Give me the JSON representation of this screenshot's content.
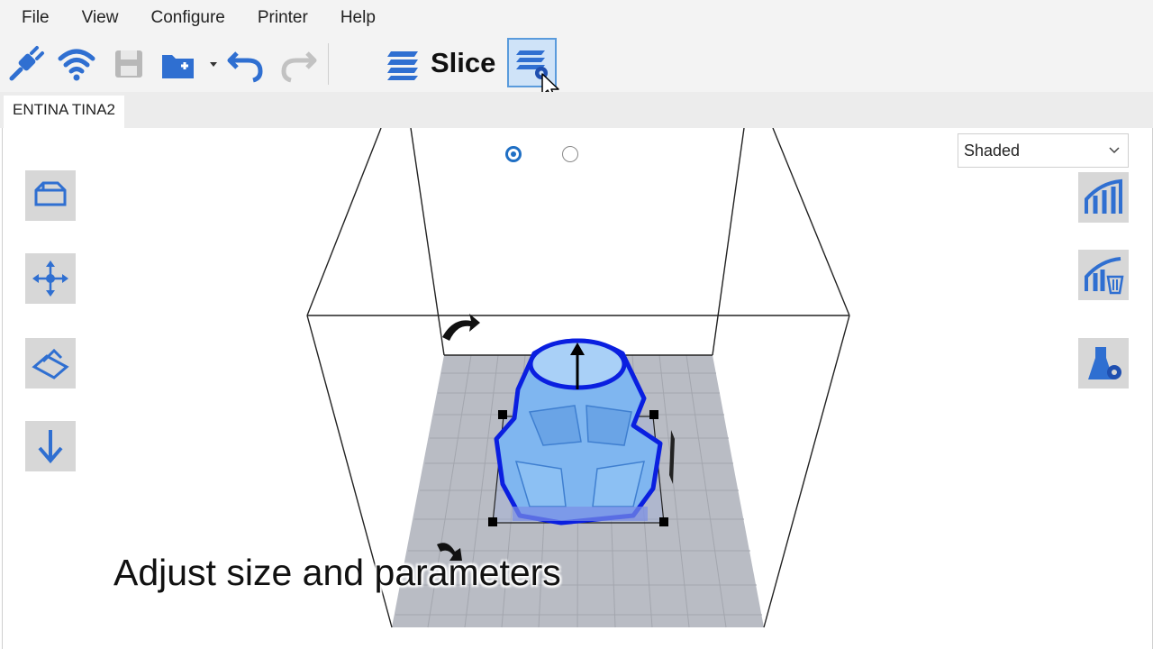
{
  "menu": [
    "File",
    "View",
    "Configure",
    "Printer",
    "Help"
  ],
  "toolbar": {
    "slice_label": "Slice",
    "icons": [
      "usb-connect-icon",
      "wifi-icon",
      "save-icon",
      "open-folder-icon",
      "undo-icon",
      "redo-icon",
      "slice-layers-icon",
      "slice-settings-icon"
    ]
  },
  "tabs": [
    "ENTINA TINA2"
  ],
  "viewport": {
    "view_mode": "Shaded",
    "left_tools": [
      "view-box-icon",
      "center-move-icon",
      "lay-flat-icon",
      "drop-down-icon"
    ],
    "right_tools": [
      "support-icon",
      "delete-support-icon",
      "support-settings-icon"
    ]
  },
  "caption": "Adjust size and parameters",
  "colors": {
    "accent": "#1f6fc4",
    "model": "#7fb6f0",
    "outline": "#0a1fe0",
    "plate": "#b9bcc4"
  }
}
